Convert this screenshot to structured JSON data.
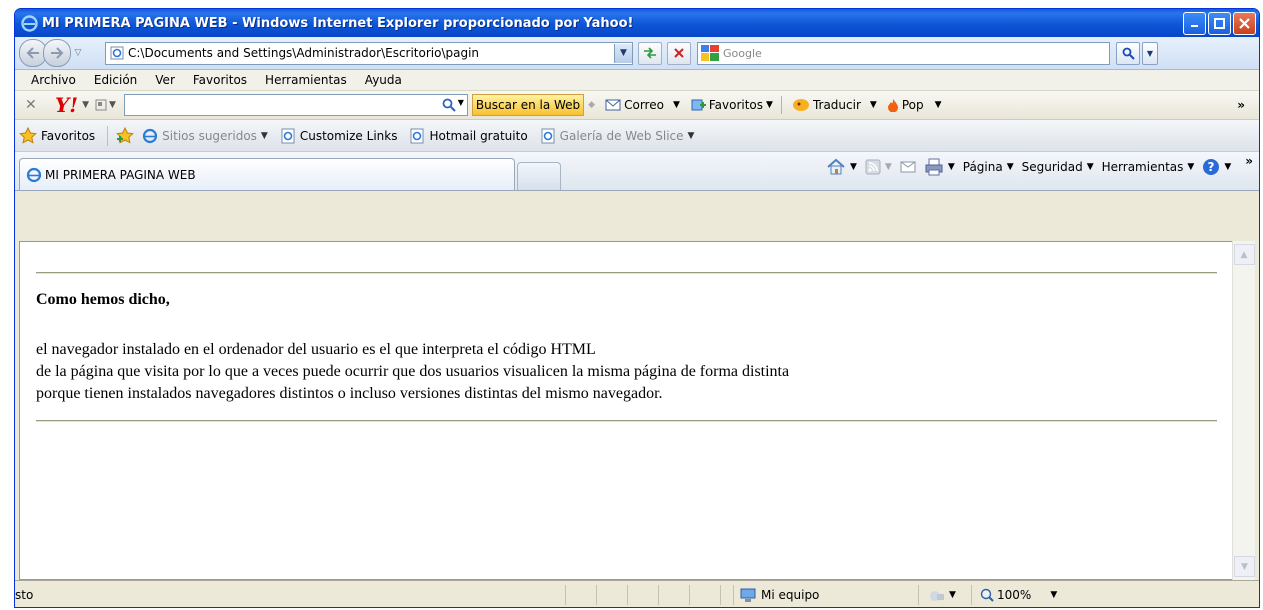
{
  "window": {
    "title": "MI PRIMERA PAGINA WEB - Windows Internet Explorer proporcionado por Yahoo!"
  },
  "address_bar": {
    "url": "C:\\Documents and Settings\\Administrador\\Escritorio\\pagin",
    "search_placeholder": "Google"
  },
  "menu": {
    "items": [
      "Archivo",
      "Edición",
      "Ver",
      "Favoritos",
      "Herramientas",
      "Ayuda"
    ]
  },
  "yahoo_toolbar": {
    "search_button": "Buscar en la Web",
    "correo": "Correo",
    "favoritos": "Favoritos",
    "traducir": "Traducir",
    "pop": "Pop"
  },
  "favorites_bar": {
    "favoritos": "Favoritos",
    "links": [
      "Sitios sugeridos",
      "Customize Links",
      "Hotmail gratuito",
      "Galería de Web Slice"
    ]
  },
  "tab": {
    "title": "MI PRIMERA PAGINA WEB"
  },
  "command_bar": {
    "pagina": "Página",
    "seguridad": "Seguridad",
    "herramientas": "Herramientas"
  },
  "page": {
    "heading": "Como hemos dicho,",
    "lines": [
      "el navegador instalado en el ordenador del usuario es el que interpreta el código HTML",
      "de la página que visita por lo que a veces puede ocurrir que dos usuarios visualicen la misma página de forma distinta",
      "porque tienen instalados navegadores distintos o incluso versiones distintas del mismo navegador."
    ]
  },
  "status_bar": {
    "status": "Listo",
    "zone": "Mi equipo",
    "zoom": "100%"
  },
  "colors": {
    "titlebar": "#0d56d6",
    "yahoo_red": "#dd0000",
    "search_button": "#f8c030"
  }
}
